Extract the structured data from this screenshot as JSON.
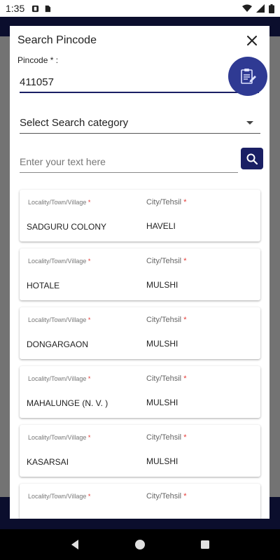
{
  "status_bar": {
    "time": "1:35"
  },
  "dialog": {
    "title": "Search Pincode",
    "pincode_label": "Pincode * :",
    "pincode_value": "411057",
    "category_select": {
      "selected": "Select Search category"
    },
    "search": {
      "placeholder": "Enter your text here"
    }
  },
  "results": {
    "locality_label": "Locality/Town/Village",
    "city_label": "City/Tehsil",
    "required_mark": "*",
    "rows": [
      {
        "locality": "SADGURU COLONY",
        "city": "HAVELI"
      },
      {
        "locality": "HOTALE",
        "city": "MULSHI"
      },
      {
        "locality": "DONGARGAON",
        "city": "MULSHI"
      },
      {
        "locality": "MAHALUNGE (N. V. )",
        "city": "MULSHI"
      },
      {
        "locality": "KASARSAI",
        "city": "MULSHI"
      },
      {
        "locality": "",
        "city": ""
      }
    ]
  },
  "colors": {
    "primary": "#1a1f64",
    "fab": "#2f3a93",
    "required": "#e53935"
  }
}
